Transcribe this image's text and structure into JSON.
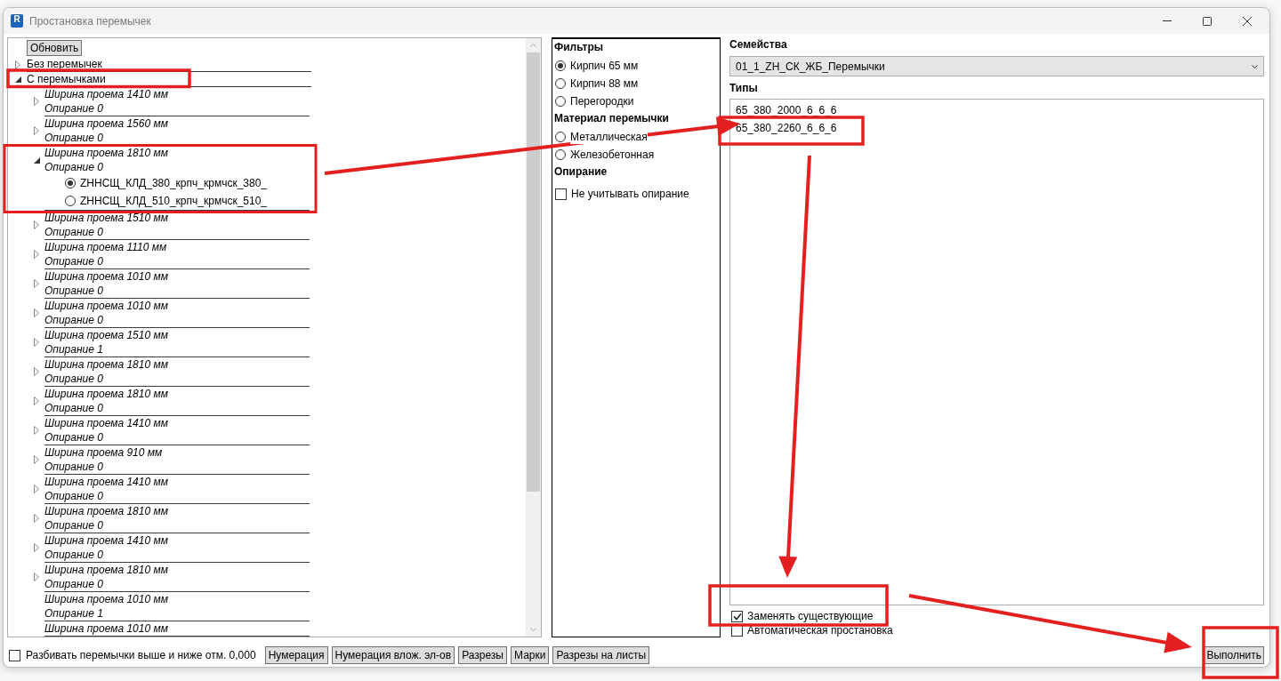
{
  "window": {
    "title": "Простановка перемычек",
    "icon_letter": "R"
  },
  "tree": {
    "refresh_button": "Обновить",
    "items": [
      {
        "label": "Без перемычек",
        "expanded": false
      },
      {
        "label": "С перемычками",
        "expanded": true,
        "children": [
          {
            "kind": "node",
            "title": "Ширина проема 1410 мм",
            "subtitle": "Опирание 0",
            "expanded": false
          },
          {
            "kind": "node",
            "title": "Ширина проема 1560 мм",
            "subtitle": "Опирание 0",
            "expanded": false
          },
          {
            "kind": "node",
            "title": "Ширина проема 1810 мм",
            "subtitle": "Опирание 0",
            "expanded": true,
            "children": [
              {
                "label": "ZHНСЩ_КЛД_380_крпч_крмчск_380_",
                "selected": true
              },
              {
                "label": "ZHНСЩ_КЛД_510_крпч_крмчск_510_",
                "selected": false
              }
            ]
          },
          {
            "kind": "node",
            "title": "Ширина проема 1510 мм",
            "subtitle": "Опирание 0",
            "expanded": false
          },
          {
            "kind": "node",
            "title": "Ширина проема 1110 мм",
            "subtitle": "Опирание 0",
            "expanded": false
          },
          {
            "kind": "node",
            "title": "Ширина проема 1010 мм",
            "subtitle": "Опирание 0",
            "expanded": false
          },
          {
            "kind": "node",
            "title": "Ширина проема 1010 мм",
            "subtitle": "Опирание 0",
            "expanded": false
          },
          {
            "kind": "node",
            "title": "Ширина проема 1510 мм",
            "subtitle": "Опирание 1",
            "expanded": false
          },
          {
            "kind": "node",
            "title": "Ширина проема 1810 мм",
            "subtitle": "Опирание 0",
            "expanded": false
          },
          {
            "kind": "node",
            "title": "Ширина проема 1810 мм",
            "subtitle": "Опирание 0",
            "expanded": false
          },
          {
            "kind": "node",
            "title": "Ширина проема 1410 мм",
            "subtitle": "Опирание 0",
            "expanded": false
          },
          {
            "kind": "node",
            "title": "Ширина проема 910 мм",
            "subtitle": "Опирание 0",
            "expanded": false
          },
          {
            "kind": "node",
            "title": "Ширина проема 1410 мм",
            "subtitle": "Опирание 0",
            "expanded": false
          },
          {
            "kind": "node",
            "title": "Ширина проема 1810 мм",
            "subtitle": "Опирание 0",
            "expanded": false
          },
          {
            "kind": "node",
            "title": "Ширина проема 1410 мм",
            "subtitle": "Опирание 0",
            "expanded": false
          },
          {
            "kind": "node",
            "title": "Ширина проема 1810 мм",
            "subtitle": "Опирание 0",
            "expanded": false
          },
          {
            "kind": "leaf",
            "title": "Ширина проема 1010 мм",
            "subtitle": "Опирание 1"
          },
          {
            "kind": "leaf",
            "title": "Ширина проема 1010 мм"
          }
        ]
      }
    ]
  },
  "filters": {
    "sections": [
      {
        "title": "Фильтры",
        "options": [
          {
            "kind": "radio",
            "label": "Кирпич 65 мм",
            "selected": true
          },
          {
            "kind": "radio",
            "label": "Кирпич 88 мм",
            "selected": false
          },
          {
            "kind": "radio",
            "label": "Перегородки",
            "selected": false
          }
        ]
      },
      {
        "title": "Материал перемычки",
        "options": [
          {
            "kind": "radio",
            "label": "Металлическая",
            "selected": false
          },
          {
            "kind": "radio",
            "label": "Железобетонная",
            "selected": false
          }
        ]
      },
      {
        "title": "Опирание",
        "options": [
          {
            "kind": "checkbox",
            "label": "Не учитывать опирание",
            "checked": false
          }
        ]
      }
    ]
  },
  "families": {
    "label": "Семейства",
    "value": "01_1_ZH_СК_ЖБ_Перемычки"
  },
  "types": {
    "label": "Типы",
    "items": [
      {
        "label": "65_380_2000_6_6_6",
        "selected": false
      },
      {
        "label": "65_380_2260_6_6_6",
        "selected": false
      }
    ]
  },
  "options": [
    {
      "label": "Заменять существующие",
      "checked": true
    },
    {
      "label": "Автоматическая простановка",
      "checked": false
    }
  ],
  "run_button": "Выполнить",
  "bottom_bar": {
    "split_option": {
      "label": "Разбивать перемычки выше и ниже отм. 0,000",
      "checked": false
    },
    "buttons": [
      "Нумерация",
      "Нумерация влож. эл-ов",
      "Разрезы",
      "Марки",
      "Разрезы на листы"
    ]
  }
}
